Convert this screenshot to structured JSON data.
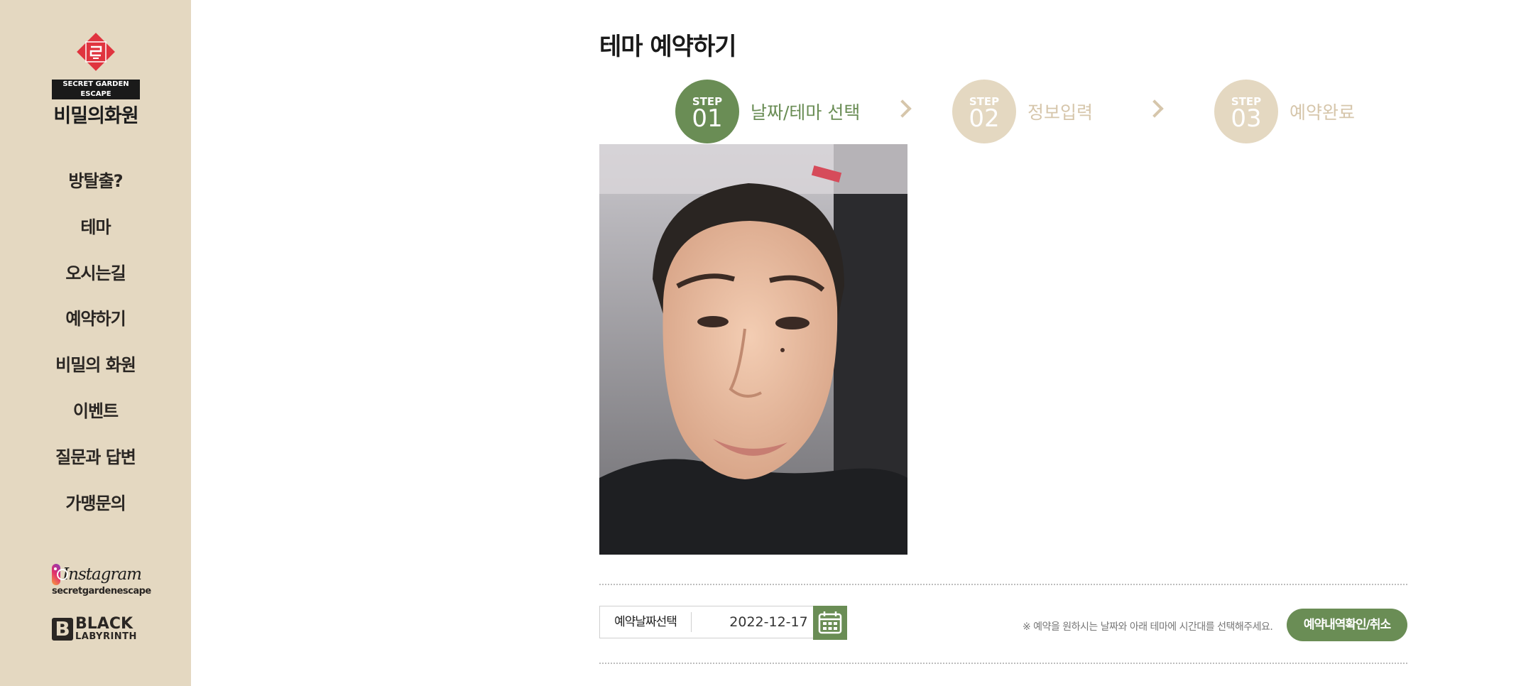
{
  "sidebar": {
    "logo": {
      "subtitle": "SECRET GARDEN ESCAPE",
      "name": "비밀의화원"
    },
    "nav": [
      {
        "label": "방탈출?"
      },
      {
        "label": "테마"
      },
      {
        "label": "오시는길"
      },
      {
        "label": "예약하기"
      },
      {
        "label": "비밀의 화원"
      },
      {
        "label": "이벤트"
      },
      {
        "label": "질문과 답변"
      },
      {
        "label": "가맹문의"
      }
    ],
    "instagram": {
      "wordmark": "Instagram",
      "handle": "secretgardenescape"
    },
    "black_labyrinth": {
      "initial": "B",
      "line1": "BLACK",
      "line2": "LABYRINTH"
    }
  },
  "main": {
    "title": "테마 예약하기",
    "steps": [
      {
        "word": "STEP",
        "num": "01",
        "label": "날짜/테마 선택",
        "state": "active"
      },
      {
        "word": "STEP",
        "num": "02",
        "label": "정보입력",
        "state": "inactive"
      },
      {
        "word": "STEP",
        "num": "03",
        "label": "예약완료",
        "state": "inactive"
      }
    ],
    "date_picker": {
      "label": "예약날짜선택",
      "value": "2022-12-17"
    },
    "notice": "※ 예약을 원하시는 날짜와 아래 테마에 시간대를 선택해주세요.",
    "check_button": "예약내역확인/취소"
  },
  "colors": {
    "sidebar_bg": "#e4d8c1",
    "accent_green": "#6a8d55",
    "inactive_step": "#e4d8c1",
    "inactive_text": "#d6c6ab",
    "logo_red": "#e0343f"
  }
}
